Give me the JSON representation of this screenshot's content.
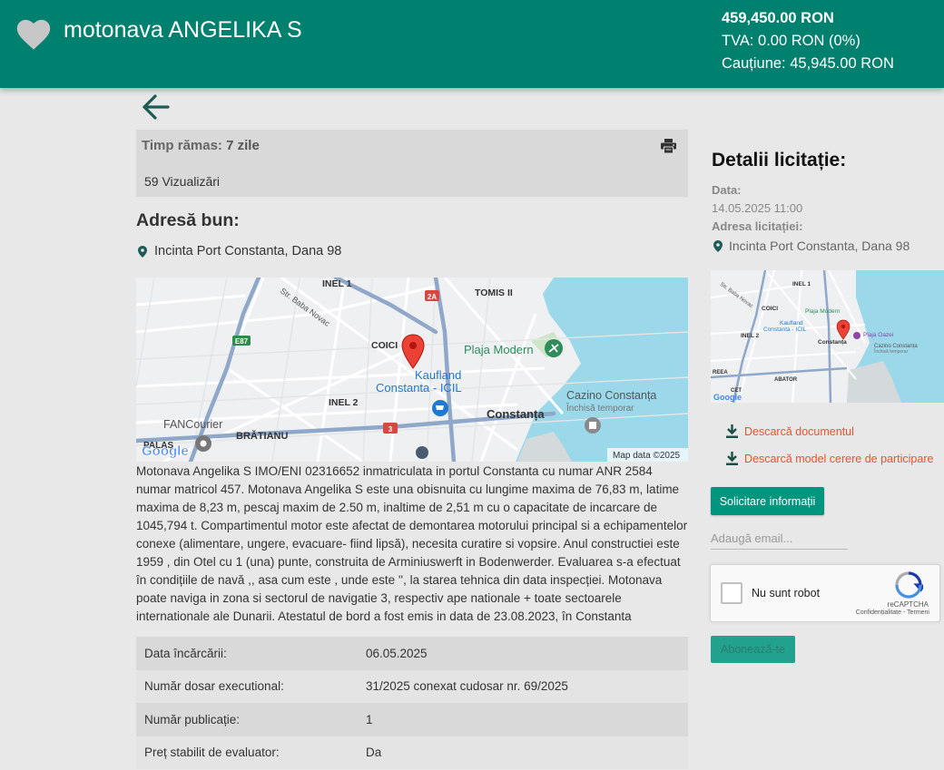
{
  "header": {
    "title": "motonava ANGELIKA S",
    "price": "459,450.00 RON",
    "tva": "TVA: 0.00 RON (0%)",
    "guarantee": "Cauțiune: 45,945.00 RON"
  },
  "status": {
    "time_label": "Timp rămas:",
    "time_value": "7 zile",
    "views": "59 Vizualizări"
  },
  "address": {
    "heading": "Adresă bun:",
    "text": "Incinta Port Constanta, Dana 98"
  },
  "map_big": {
    "labels": {
      "inel1": "INEL 1",
      "tomis": "TOMIS II",
      "baba": "Str. Baba Novac",
      "e87": "E87",
      "a2": "2A",
      "coici": "COICI",
      "plaja": "Plaja Modern",
      "kaufland1": "Kaufland",
      "kaufland2": "Constanta - ICIL",
      "inel2": "INEL 2",
      "cazino1": "Cazino Constanța",
      "cazino2": "Închisă temporar",
      "constanta": "Constanța",
      "fancourier": "FANCourier",
      "bratianu": "BRĂTIANU",
      "r3": "3",
      "palas": "PALAS",
      "google": "Google",
      "mapdata": "Map data ©2025"
    }
  },
  "description": "Motonava Angelika S IMO/ENI 02316652 inmatriculata in portul Constanta cu numar ANR 2584 numar matricol 457. Motonava Angelika S este una obisnuita cu lungime maxima de 76,83 m, latime maxima de 8,23 m, pescaj maxim de 2.50 m, inaltime de 2,51 m cu o capacitate de incarcare de 1045,794 t. Compartimentul motor este afectat de demontarea motorului principal si a echipamentelor conexe (alimentare, ungere, evacuare- fiind lipsă), necesita curatire si vopsire. Anul constructiei este 1959 , din Otel cu 1 (una) punte, construita de Arminiuswerft in Bodenwerder. Evaluarea s-a efectuat în condițiile de navă ,, asa cum este , unde este '', la starea tehnica din data inspecției. Motonava poate naviga in zona si sectorul de navigatie 3, respectiv ape nationale + toate sectoarele internationale ale Dunarii. Atestatul de bord a fost emis in data de 23.08.2023, în Constanta",
  "table": {
    "rows": [
      {
        "key": "Data încărcării:",
        "value": "06.05.2025"
      },
      {
        "key": "Număr dosar executional:",
        "value": "31/2025 conexat cudosar nr. 69/2025"
      },
      {
        "key": "Număr publicație:",
        "value": "1"
      },
      {
        "key": "Preț stabilit de evaluator:",
        "value": "Da"
      }
    ]
  },
  "details": {
    "title": "Detalii licitație:",
    "date_label": "Data:",
    "date_value": "14.05.2025 11:00",
    "addr_label": "Adresa licitației:",
    "addr_value": "Incinta Port Constanta, Dana 98"
  },
  "map_small": {
    "labels": {
      "baba": "Str. Baba Novac",
      "inel1": "INEL 1",
      "coici": "COICI",
      "plaja": "Plaja Modern",
      "kaufland1": "Kaufland",
      "kaufland2": "Constanta - ICIL",
      "plaja2": "Plaja Oazei",
      "inel2": "INEL 2",
      "constanta": "Constanța",
      "cazino1": "Cazino Constanța",
      "cazino2": "Închisă temporar",
      "abator": "ABATOR",
      "reea": "REEA",
      "cet": "CET",
      "google": "Google"
    }
  },
  "downloads": {
    "doc": "Descarcă documentul",
    "model": "Descarcă model cerere de participare"
  },
  "actions": {
    "request_info": "Solicitare informații",
    "email_placeholder": "Adaugă email...",
    "subscribe": "Abonează-te"
  },
  "captcha": {
    "label": "Nu sunt robot",
    "brand": "reCAPTCHA",
    "links": "Confidențialitate - Termeni"
  },
  "colors": {
    "header": "#00806f",
    "accent": "#00957f",
    "download": "#e8532f"
  }
}
